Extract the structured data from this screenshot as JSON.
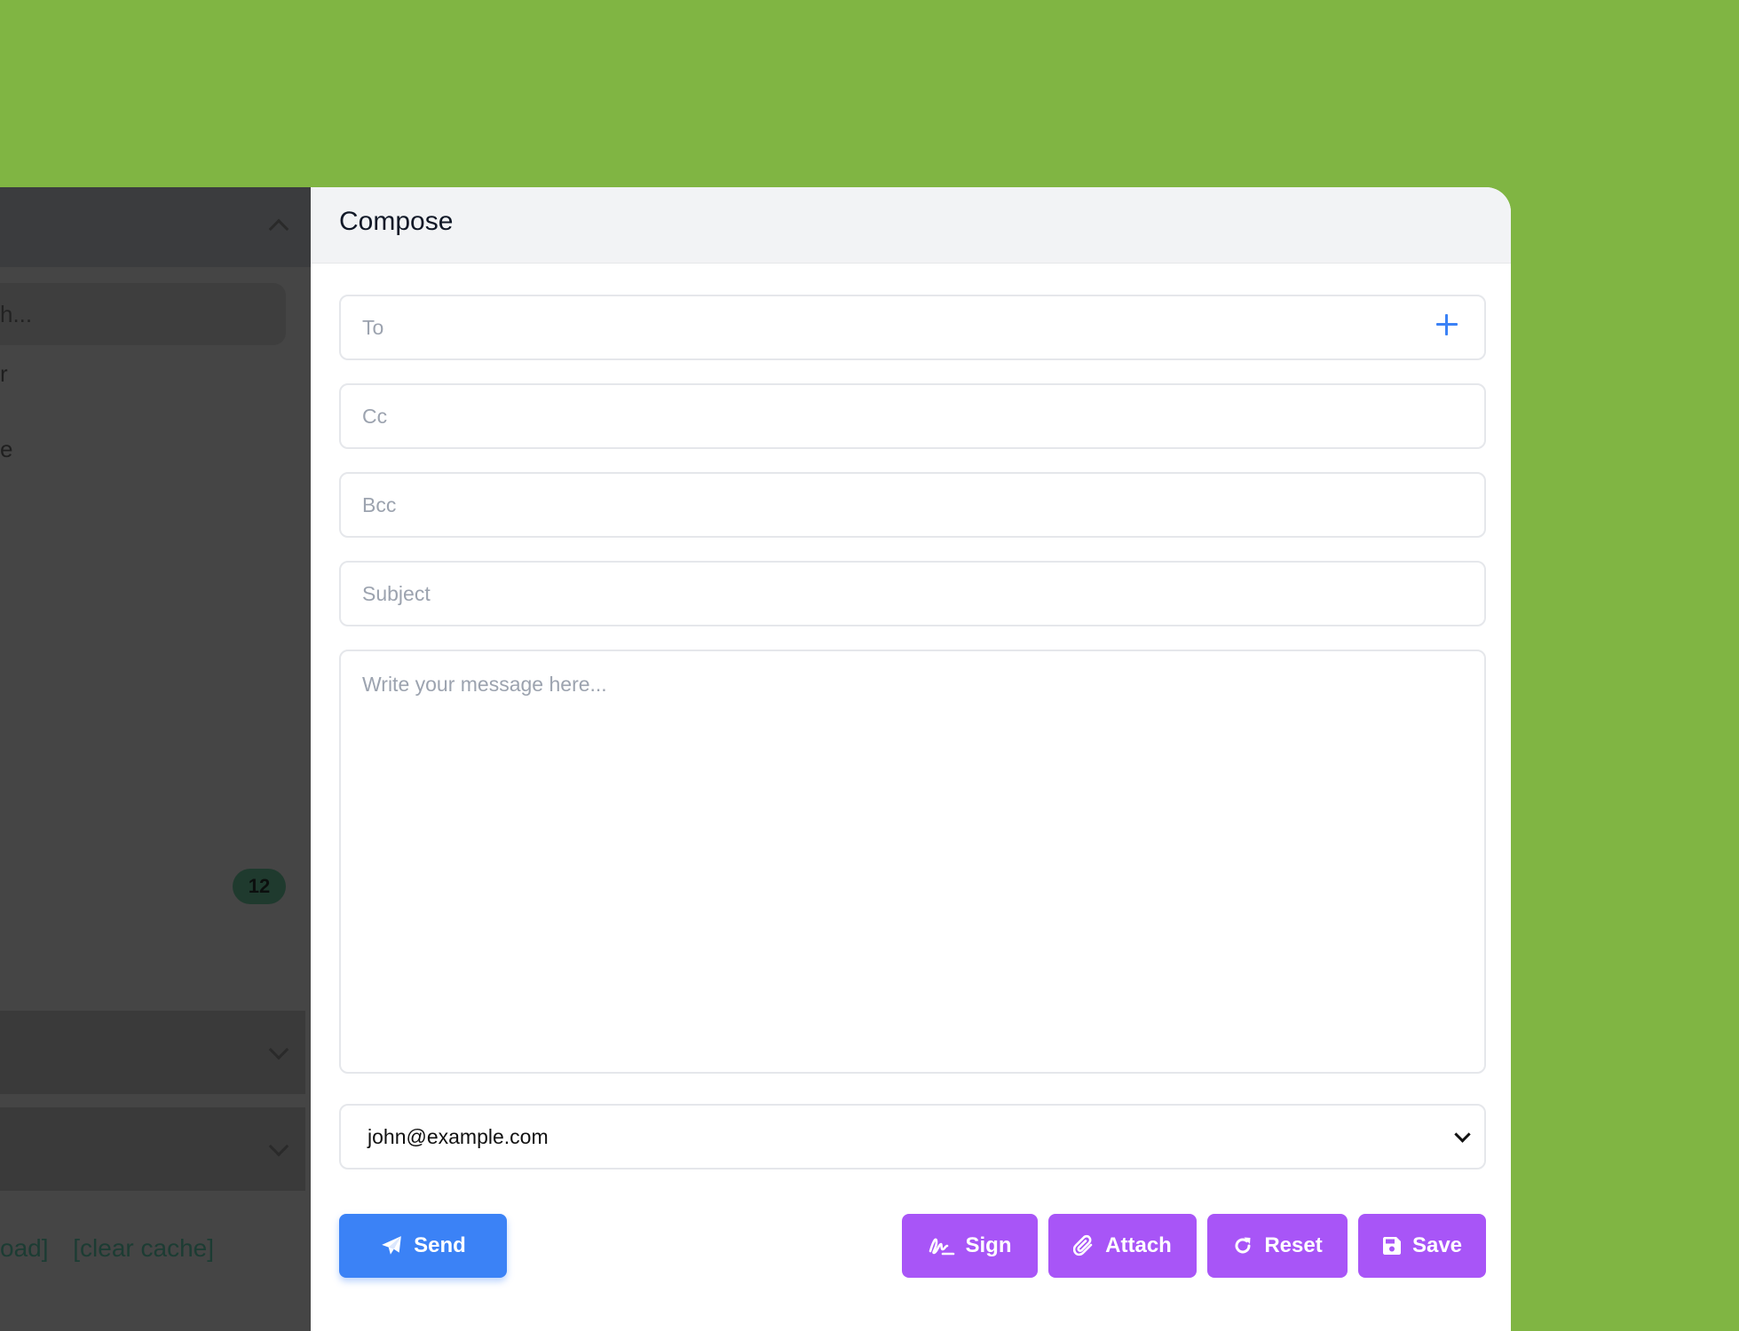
{
  "sidebar": {
    "search_fragment": "h...",
    "item_fragment_1": "r",
    "item_fragment_2": "e",
    "badge_count": "12",
    "footer_links": [
      "oad]",
      "[clear cache]"
    ]
  },
  "compose": {
    "title": "Compose",
    "to_placeholder": "To",
    "cc_placeholder": "Cc",
    "bcc_placeholder": "Bcc",
    "subject_placeholder": "Subject",
    "message_placeholder": "Write your message here...",
    "from_selected": "john@example.com"
  },
  "buttons": {
    "send": "Send",
    "sign": "Sign",
    "attach": "Attach",
    "reset": "Reset",
    "save": "Save"
  },
  "icons": {
    "add_recipient": "plus-icon",
    "send": "paper-plane-icon",
    "sign": "signature-icon",
    "attach": "paperclip-icon",
    "reset": "redo-icon",
    "save": "floppy-disk-icon"
  },
  "colors": {
    "background": "#80b543",
    "primary": "#3b82f6",
    "secondary": "#a855f7",
    "sidebar_overlay": "#454545"
  }
}
